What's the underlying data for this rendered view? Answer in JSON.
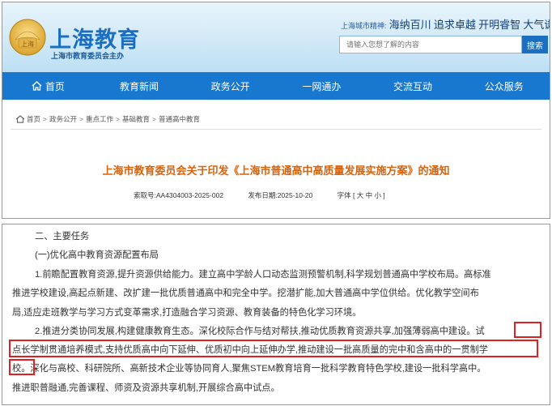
{
  "header": {
    "site_title": "上海教育",
    "site_subtitle": "上海市教育委员会主办",
    "logo_text": "上海",
    "spirit_label": "上海城市精神:",
    "spirit_text": "海纳百川 追求卓越 开明睿智 大气谦和",
    "search_placeholder": "请输入您想了解的内容",
    "search_button": "搜索"
  },
  "nav": {
    "home": "首页",
    "news": "教育新闻",
    "gov": "政务公开",
    "online": "一网通办",
    "interact": "交流互动",
    "service": "公众服务"
  },
  "breadcrumb": {
    "home": "首页",
    "c1": "政务公开",
    "c2": "重点工作",
    "c3": "基础教育",
    "c4": "普通高中教育",
    "sep": ">"
  },
  "article": {
    "title": "上海市教育委员会关于印发《上海市普通高中高质量发展实施方案》的通知",
    "index_no": "索取号:AA4304003-2025-002",
    "date": "发布日期:2025-10-20",
    "font_size": "字体 [ 大 中 小 ]"
  },
  "body": {
    "h2": "二、主要任务",
    "h3": "(一)优化高中教育资源配置布局",
    "lines": [
      "1.前瞻配置教育资源,提升资源供给能力。建立高中学龄人口动态监测预警机制,科学规划普通高中学校布局。高标准",
      "推进学校建设,高起点新建、改扩建一批优质普通高中和完全中学。挖潜扩能,加大普通高中学位供给。优化教学空间布",
      "局,适应走班教学与学习方式变革需求,打造融合学习资源、教育装备的特色化学习环境。",
      "2.推进分类协同发展,构建健康教育生态。深化校际合作与结对帮扶,推动优质教育资源共享,加强薄弱高中建设。试",
      "点长学制贯通培养模式,支持优质高中向下延伸、优质初中向上延伸办学,推动建设一批高质量的完中和含高中的一贯制学",
      "校。深化与高校、科研院所、高新技术企业等协同育人,聚焦STEM教育培育一批科学教育特色学校,建设一批科学高中。",
      "推进职普融通,完善课程、师资及资源共享机制,开展综合高中试点。"
    ]
  },
  "colors": {
    "brand_blue": "#1878cf",
    "title_orange": "#d9620a",
    "highlight_red": "#e02020"
  }
}
